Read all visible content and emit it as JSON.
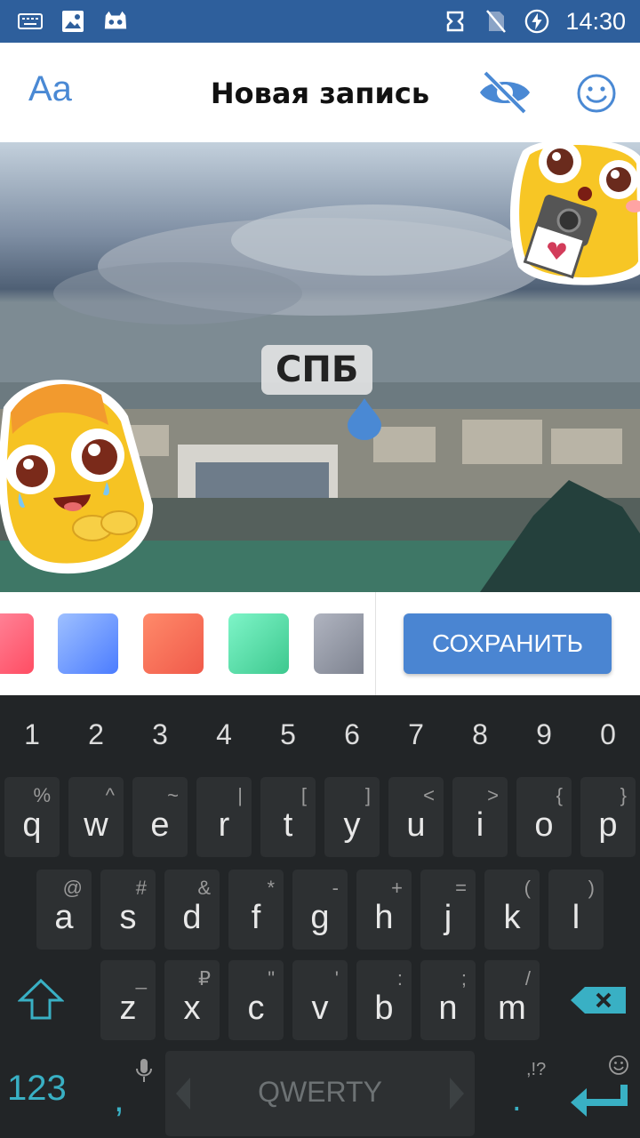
{
  "status_bar": {
    "time": "14:30",
    "icons_left": [
      "keyboard-icon",
      "image-icon",
      "game-icon"
    ],
    "icons_right": [
      "sync-icon",
      "no-sim-icon",
      "battery-charging-icon"
    ]
  },
  "header": {
    "text_style_label": "Aa",
    "title": "Новая запись",
    "visibility_icon": "eye-off-icon",
    "sticker_icon": "smile-icon",
    "accent": "#4a89d4"
  },
  "editor": {
    "text_label": "СПБ",
    "stickers": [
      "camera-duck-sticker",
      "pleading-duck-sticker"
    ]
  },
  "toolbar": {
    "swatches": [
      {
        "name": "pink-red",
        "from": "#ff6b84",
        "to": "#ff4d63"
      },
      {
        "name": "blue",
        "from": "#8fb4ff",
        "to": "#4b7cff"
      },
      {
        "name": "coral",
        "from": "#ff8a6a",
        "to": "#f05a4a"
      },
      {
        "name": "mint",
        "from": "#6ff0c0",
        "to": "#3dc88e"
      },
      {
        "name": "gray",
        "from": "#a4a8b4",
        "to": "#7e8390"
      }
    ],
    "save_label": "СОХРАНИТЬ",
    "save_color": "#4a85d2"
  },
  "keyboard": {
    "numbers": [
      "1",
      "2",
      "3",
      "4",
      "5",
      "6",
      "7",
      "8",
      "9",
      "0"
    ],
    "row1": [
      {
        "ch": "q",
        "hint": "%"
      },
      {
        "ch": "w",
        "hint": "^"
      },
      {
        "ch": "e",
        "hint": "~"
      },
      {
        "ch": "r",
        "hint": "|"
      },
      {
        "ch": "t",
        "hint": "["
      },
      {
        "ch": "y",
        "hint": "]"
      },
      {
        "ch": "u",
        "hint": "<"
      },
      {
        "ch": "i",
        "hint": ">"
      },
      {
        "ch": "o",
        "hint": "{"
      },
      {
        "ch": "p",
        "hint": "}"
      }
    ],
    "row2": [
      {
        "ch": "a",
        "hint": "@"
      },
      {
        "ch": "s",
        "hint": "#"
      },
      {
        "ch": "d",
        "hint": "&"
      },
      {
        "ch": "f",
        "hint": "*"
      },
      {
        "ch": "g",
        "hint": "-"
      },
      {
        "ch": "h",
        "hint": "+"
      },
      {
        "ch": "j",
        "hint": "="
      },
      {
        "ch": "k",
        "hint": "("
      },
      {
        "ch": "l",
        "hint": ")"
      }
    ],
    "row3": [
      {
        "ch": "z",
        "hint": "_"
      },
      {
        "ch": "x",
        "hint": "₽"
      },
      {
        "ch": "c",
        "hint": "\""
      },
      {
        "ch": "v",
        "hint": "'"
      },
      {
        "ch": "b",
        "hint": ":"
      },
      {
        "ch": "n",
        "hint": ";"
      },
      {
        "ch": "m",
        "hint": "/"
      }
    ],
    "symbols_label": "123",
    "comma_label": ",",
    "space_label": "QWERTY",
    "period_label": ".",
    "punct_hint": ",!?",
    "accent": "#39b0c4"
  }
}
